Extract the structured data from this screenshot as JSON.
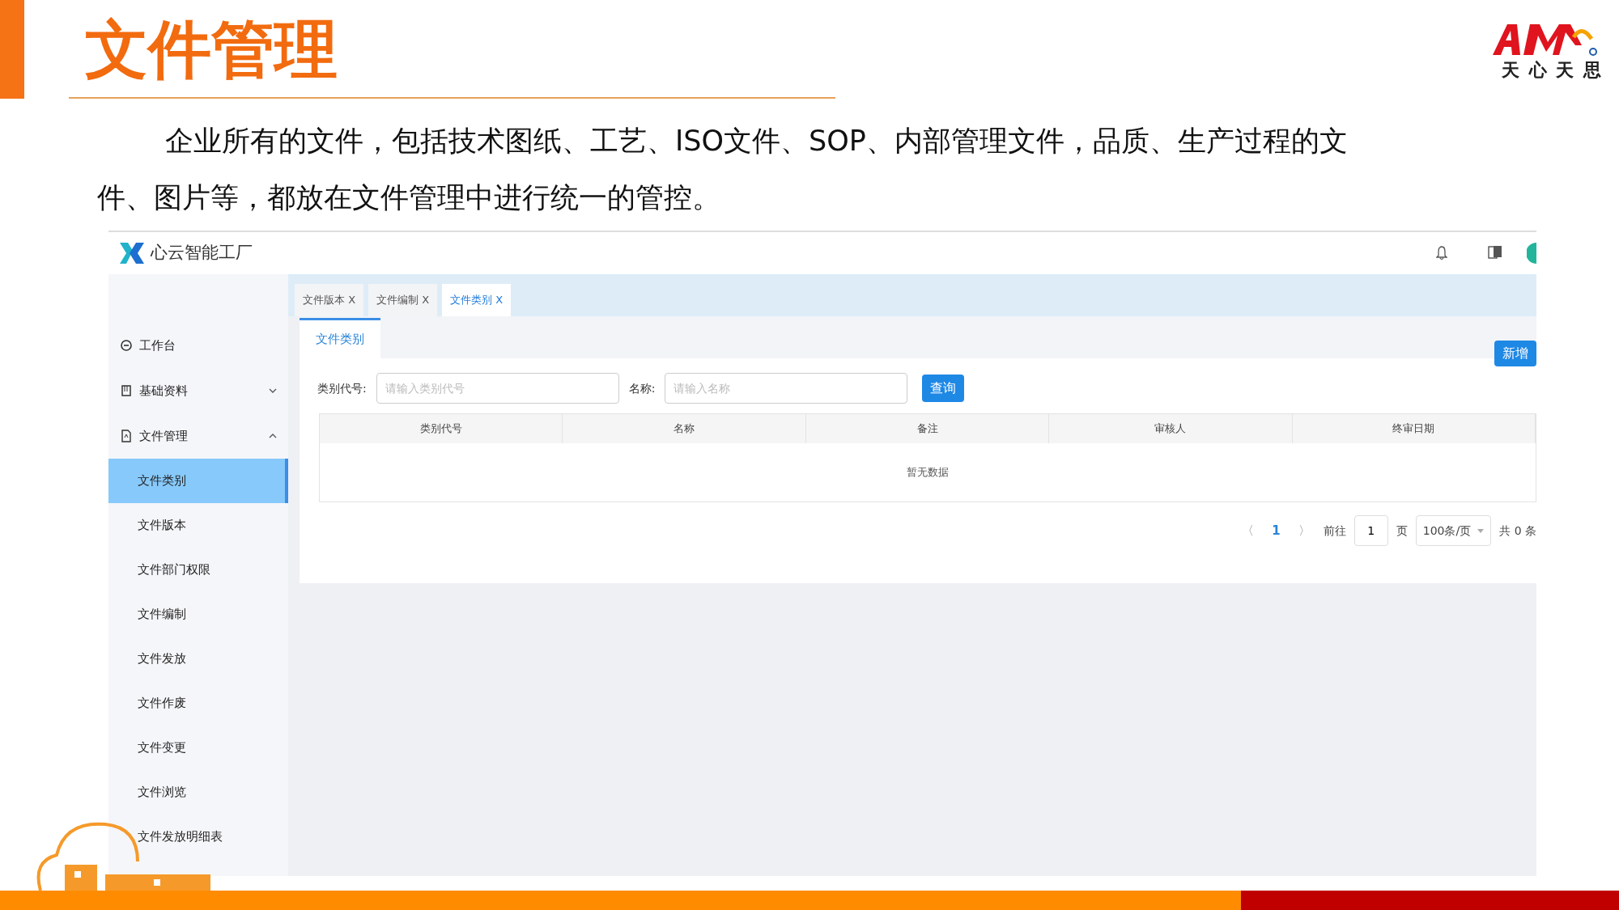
{
  "slide": {
    "title": "文件管理",
    "body": "企业所有的文件，包括技术图纸、工艺、ISO文件、SOP、内部管理文件，品质、生产过程的文件、图片等，都放在文件管理中进行统一的管控。",
    "logo_caption": "天 心 天 思"
  },
  "app": {
    "brand": "心云智能工厂",
    "sidebar": [
      {
        "label": "工作台"
      },
      {
        "label": "基础资料",
        "expanded": false
      },
      {
        "label": "文件管理",
        "expanded": true,
        "children": [
          {
            "label": "文件类别",
            "selected": true
          },
          {
            "label": "文件版本",
            "selected": false
          },
          {
            "label": "文件部门权限",
            "selected": false
          },
          {
            "label": "文件编制",
            "selected": false
          },
          {
            "label": "文件发放",
            "selected": false
          },
          {
            "label": "文件作废",
            "selected": false
          },
          {
            "label": "文件变更",
            "selected": false
          },
          {
            "label": "文件浏览",
            "selected": false
          },
          {
            "label": "文件发放明细表",
            "selected": false
          }
        ]
      }
    ],
    "tabs": [
      {
        "label": "文件版本",
        "close": "X",
        "selected": false
      },
      {
        "label": "文件编制",
        "close": "X",
        "selected": false
      },
      {
        "label": "文件类别",
        "close": "X",
        "selected": true
      }
    ],
    "page_tab": "文件类别",
    "add_button": "新增",
    "filters": [
      {
        "label": "类别代号:",
        "placeholder": "请输入类别代号"
      },
      {
        "label": "名称:",
        "placeholder": "请输入名称"
      }
    ],
    "search_button": "查询",
    "table": {
      "columns": [
        "类别代号",
        "名称",
        "备注",
        "审核人",
        "终审日期"
      ],
      "empty_text": "暂无数据"
    },
    "pagination": {
      "prev": "〈",
      "pages": [
        {
          "label": "1",
          "selected": true
        }
      ],
      "next": "〉",
      "goto_label": "前往",
      "goto_value": "1",
      "page_unit": "页",
      "page_size": "100条/页",
      "total": "共 0 条"
    }
  }
}
